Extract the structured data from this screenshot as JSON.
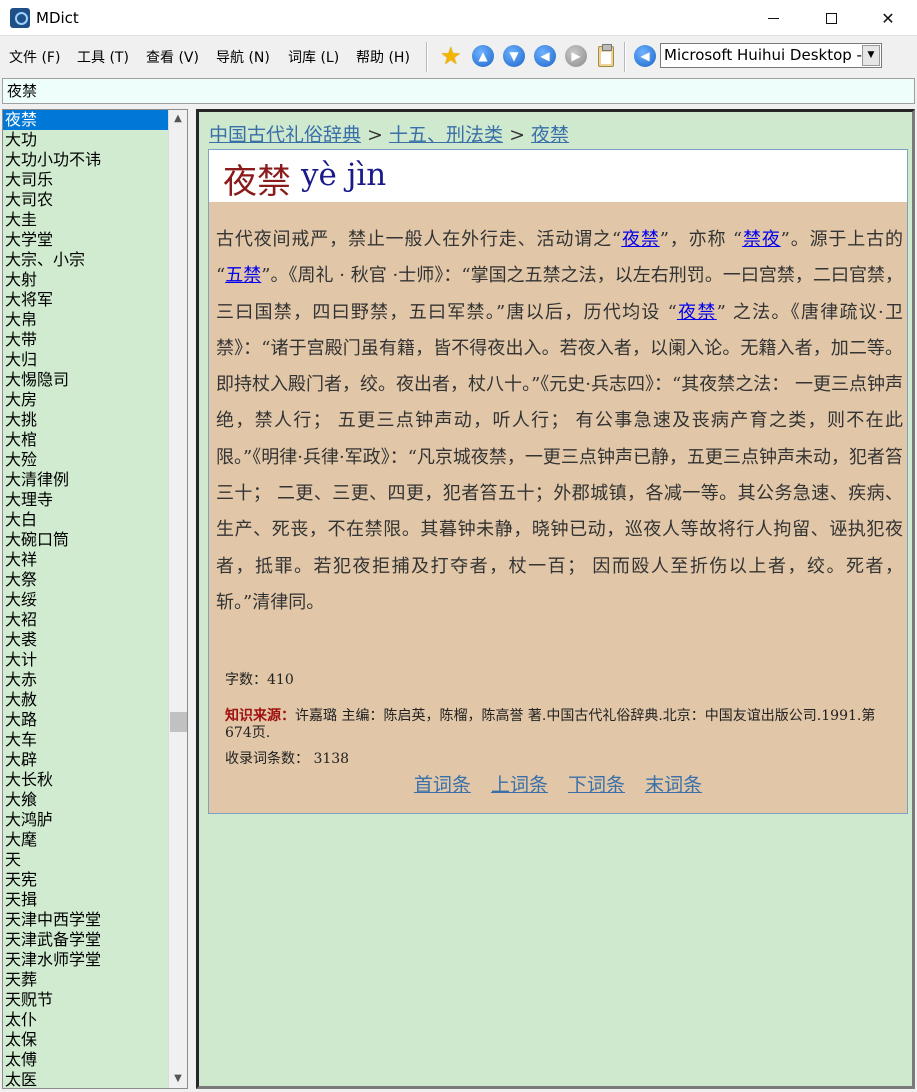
{
  "window": {
    "title": "MDict"
  },
  "menu": [
    "文件 (F)",
    "工具 (T)",
    "查看 (V)",
    "导航 (N)",
    "词库 (L)",
    "帮助 (H)"
  ],
  "toolbar": {
    "icons": [
      "star-icon",
      "arrow-up-icon",
      "arrow-down-icon",
      "back-icon",
      "forward-icon",
      "clipboard-icon",
      "speaker-icon"
    ],
    "font_select": "Microsoft Huihui Desktop -"
  },
  "search": {
    "value": "夜禁"
  },
  "wordlist": {
    "selected": "夜禁",
    "items": [
      "夜禁",
      "大功",
      "大功小功不讳",
      "大司乐",
      "大司农",
      "大圭",
      "大学堂",
      "大宗、小宗",
      "大射",
      "大将军",
      "大帛",
      "大带",
      "大归",
      "大惕隐司",
      "大房",
      "大挑",
      "大棺",
      "大殓",
      "大清律例",
      "大理寺",
      "大白",
      "大碗口筒",
      "大祥",
      "大祭",
      "大绥",
      "大袑",
      "大裘",
      "大计",
      "大赤",
      "大赦",
      "大路",
      "大车",
      "大辟",
      "大长秋",
      "大飨",
      "大鸿胪",
      "大麾",
      "天",
      "天宪",
      "天揖",
      "天津中西学堂",
      "天津武备学堂",
      "天津水师学堂",
      "天葬",
      "天贶节",
      "太仆",
      "太保",
      "太傅",
      "太医"
    ]
  },
  "content": {
    "breadcrumb": {
      "root": "中国古代礼俗辞典",
      "sep": " > ",
      "category": "十五、刑法类",
      "current": "夜禁"
    },
    "headword": "夜禁",
    "pinyin": "yè jìn",
    "body": {
      "p1": "古代夜间戒严，禁止一般人在外行走、活动谓之“",
      "link1": "夜禁",
      "p2": "”，亦称 “",
      "link2": "禁夜",
      "p3": "”。源于上古的 “",
      "link3": "五禁",
      "p4": "”。《周礼 · 秋官 ·士师》：“掌国之五禁之法，以左右刑罚。一曰宫禁，二曰官禁，三曰国禁，四曰野禁，五曰军禁。”唐以后，历代均设 “",
      "link4": "夜禁",
      "p5": "” 之法。《唐律疏议·卫禁》：“诸于宫殿门虽有籍，皆不得夜出入。若夜入者，以阑入论。无籍入者，加二等。即持杖入殿门者，绞。夜出者，杖八十。”《元史·兵志四》：“其夜禁之法： 一更三点钟声绝，禁人行； 五更三点钟声动，听人行； 有公事急速及丧病产育之类，则不在此限。”《明律·兵律·军政》：“凡京城夜禁，一更三点钟声已静，五更三点钟声未动，犯者笞三十； 二更、三更、四更，犯者笞五十；外郡城镇，各减一等。其公务急速、疾病、生产、死丧，不在禁限。其暮钟未静，晓钟已动，巡夜人等故将行人拘留、诬执犯夜者，抵罪。若犯夜拒捕及打夺者，杖一百； 因而殴人至折伤以上者，绞。死者，斩。”清律同。"
    },
    "word_count": "字数：410",
    "source_label": "知识来源：",
    "source_text": "许嘉璐 主编：陈启英，陈榴，陈高誉 著.中国古代礼俗辞典.北京：中国友谊出版公司.1991.第674页.",
    "entry_count": "收录词条数： 3138",
    "nav": {
      "first": "首词条",
      "prev": "上词条",
      "next": "下词条",
      "last": "末词条"
    }
  }
}
